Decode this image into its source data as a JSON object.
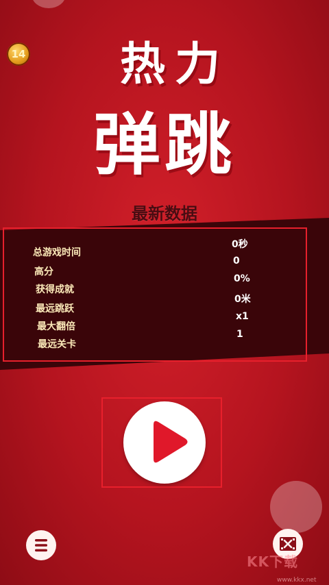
{
  "logo": {
    "line1": "热力",
    "line2": "弹跳"
  },
  "coin_badge": {
    "label": "14"
  },
  "stats": {
    "title": "最新数据",
    "rows": [
      {
        "label": "总游戏时间",
        "value": "0秒"
      },
      {
        "label": "高分",
        "value": "0"
      },
      {
        "label": "获得成就",
        "value": "0%"
      },
      {
        "label": "最远跳跃",
        "value": "0米"
      },
      {
        "label": "最大翻倍",
        "value": "x1"
      },
      {
        "label": "最远关卡",
        "value": "1"
      }
    ]
  },
  "buttons": {
    "play_icon": "play-triangle-icon",
    "menu_icon": "hamburger-menu-icon",
    "video_icon": "video-ad-icon"
  },
  "watermark": {
    "text": "KK下载",
    "url": "www.kkx.net"
  },
  "colors": {
    "background": "#c41a24",
    "band": "#3a0509",
    "highlight_frame": "#e8202c",
    "play_triangle": "#e0182a"
  }
}
